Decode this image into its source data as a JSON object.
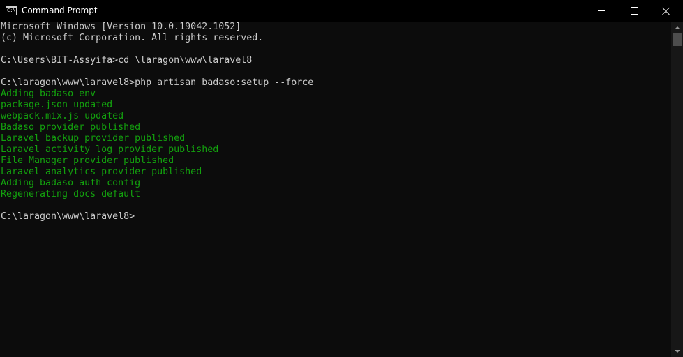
{
  "window": {
    "title": "Command Prompt",
    "icon_label": "C:\\_"
  },
  "colors": {
    "background": "#0c0c0c",
    "text_default": "#cccccc",
    "text_green": "#13a10e",
    "titlebar": "#000000"
  },
  "icons": {
    "app": "cmd-icon",
    "minimize": "minimize-icon",
    "maximize": "maximize-icon",
    "close": "close-icon"
  },
  "console": {
    "lines": [
      {
        "text": "Microsoft Windows [Version 10.0.19042.1052]",
        "color": "default"
      },
      {
        "text": "(c) Microsoft Corporation. All rights reserved.",
        "color": "default"
      },
      {
        "text": "",
        "color": "default"
      },
      {
        "text": "C:\\Users\\BIT-Assyifa>cd \\laragon\\www\\laravel8",
        "color": "default"
      },
      {
        "text": "",
        "color": "default"
      },
      {
        "text": "C:\\laragon\\www\\laravel8>php artisan badaso:setup --force",
        "color": "default"
      },
      {
        "text": "Adding badaso env",
        "color": "green"
      },
      {
        "text": "package.json updated",
        "color": "green"
      },
      {
        "text": "webpack.mix.js updated",
        "color": "green"
      },
      {
        "text": "Badaso provider published",
        "color": "green"
      },
      {
        "text": "Laravel backup provider published",
        "color": "green"
      },
      {
        "text": "Laravel activity log provider published",
        "color": "green"
      },
      {
        "text": "File Manager provider published",
        "color": "green"
      },
      {
        "text": "Laravel analytics provider published",
        "color": "green"
      },
      {
        "text": "Adding badaso auth config",
        "color": "green"
      },
      {
        "text": "Regenerating docs default",
        "color": "green"
      },
      {
        "text": "",
        "color": "default"
      },
      {
        "text": "C:\\laragon\\www\\laravel8>",
        "color": "default"
      }
    ]
  }
}
